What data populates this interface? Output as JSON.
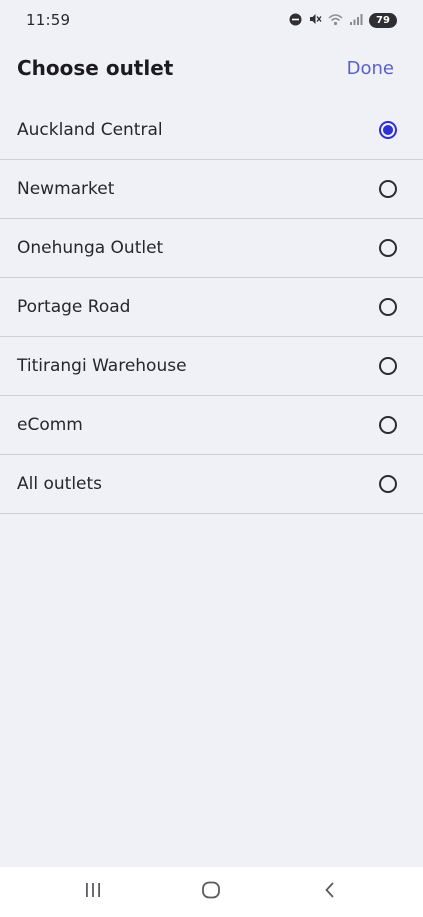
{
  "status_bar": {
    "time": "11:59",
    "battery": "79",
    "icons": [
      "do-not-disturb-icon",
      "mute-icon",
      "wifi-icon",
      "signal-icon"
    ]
  },
  "header": {
    "title": "Choose outlet",
    "done_label": "Done"
  },
  "outlets": [
    {
      "label": "Auckland Central",
      "selected": true
    },
    {
      "label": "Newmarket",
      "selected": false
    },
    {
      "label": "Onehunga Outlet",
      "selected": false
    },
    {
      "label": "Portage Road",
      "selected": false
    },
    {
      "label": "Titirangi Warehouse",
      "selected": false
    },
    {
      "label": "eComm",
      "selected": false
    },
    {
      "label": "All outlets",
      "selected": false
    }
  ],
  "nav_bar": {
    "icons": [
      "recents-icon",
      "home-icon",
      "back-icon"
    ]
  },
  "colors": {
    "accent": "#2e2fd6",
    "done": "#5b61c9",
    "background": "#f0f1f7"
  }
}
